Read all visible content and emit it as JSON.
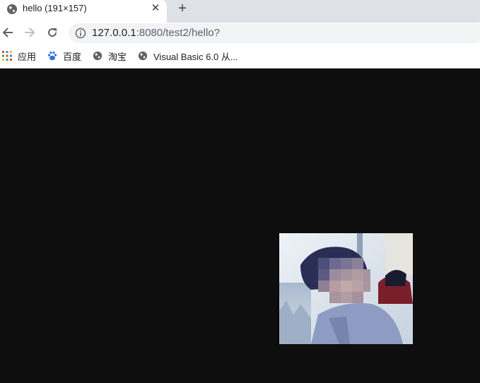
{
  "tab": {
    "title": "hello (191×157)",
    "close_glyph": "✕",
    "favicon": "globe-icon"
  },
  "new_tab_glyph": "+",
  "toolbar": {
    "back_icon": "arrow-left-icon",
    "forward_icon": "arrow-right-icon",
    "reload_icon": "reload-icon",
    "url_host": "127.0.0.1",
    "url_rest": ":8080/test2/hello?"
  },
  "bookmarks": [
    {
      "label": "应用",
      "icon": "apps-grid-icon"
    },
    {
      "label": "百度",
      "icon": "baidu-paw-icon"
    },
    {
      "label": "淘宝",
      "icon": "globe-icon"
    },
    {
      "label": "Visual Basic 6.0 从...",
      "icon": "globe-icon"
    }
  ],
  "content": {
    "background": "#0e0e0e",
    "image": "photo of a person (face pixelated) in a vehicle"
  }
}
